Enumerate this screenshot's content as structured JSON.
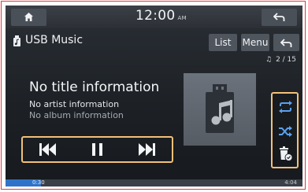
{
  "status_bar": {
    "time": "12:00",
    "ampm": "AM",
    "home_icon": "home-icon",
    "back_icon": "back-arrow-icon"
  },
  "header": {
    "source_icon": "usb-music-icon",
    "title": "USB Music",
    "list_label": "List",
    "menu_label": "Menu",
    "back_icon": "back-arrow-icon"
  },
  "track": {
    "index_icon": "music-note-icon",
    "index": "2 / 15",
    "title": "No title information",
    "artist": "No artist information",
    "album": "No album information",
    "album_art_icon": "usb-music-note-icon"
  },
  "playback": {
    "prev_icon": "skip-previous-icon",
    "pause_icon": "pause-icon",
    "next_icon": "skip-next-icon",
    "repeat_icon": "repeat-icon",
    "shuffle_icon": "shuffle-icon",
    "delete_icon": "delete-file-icon"
  },
  "progress": {
    "elapsed": "0:30",
    "total": "4:04",
    "fraction": 0.12
  },
  "colors": {
    "highlight": "#f2c078",
    "accent": "#2f73c8",
    "frame": "#e23a3a"
  }
}
